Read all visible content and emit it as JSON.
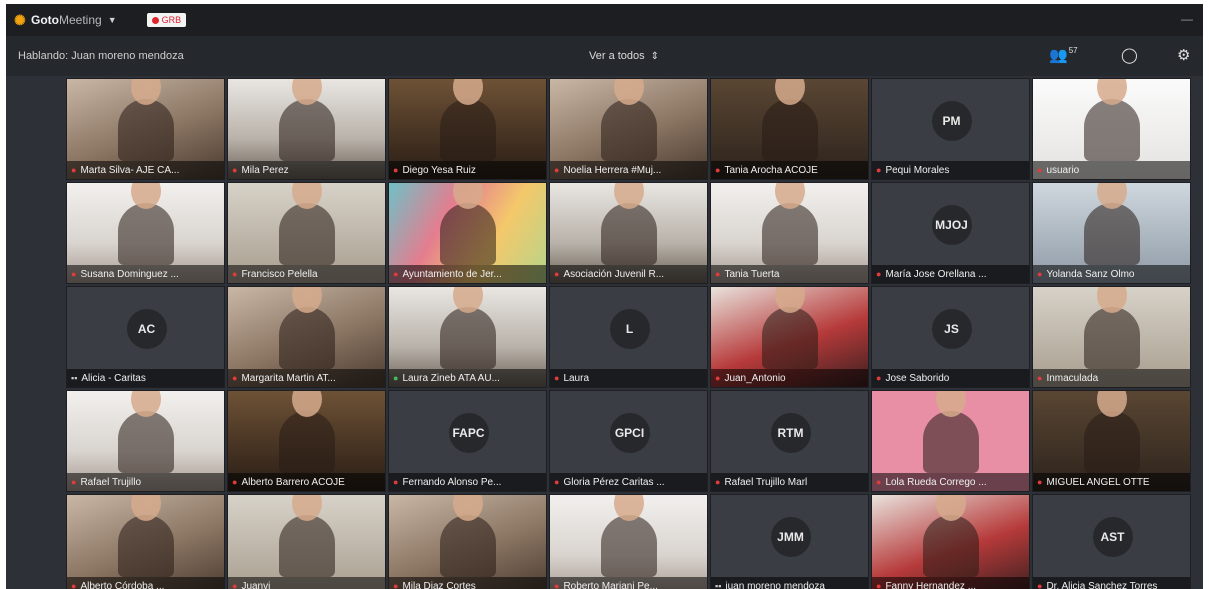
{
  "app": {
    "brand_a": "Goto",
    "brand_b": "Meeting",
    "rec_label": "GRB"
  },
  "toolbar": {
    "speaking": "Hablando: Juan moreno mendoza",
    "view_all": "Ver a todos",
    "participant_count": "57"
  },
  "colors": {
    "bg": "#2a2d33",
    "brand_orange": "#f2a30f",
    "mic_muted": "#e23b3b",
    "mic_active": "#3fbf5a"
  },
  "tiles": [
    {
      "name": "Marta Silva- AJE CA...",
      "mic": "muted",
      "style": "v-warm"
    },
    {
      "name": "Mila Perez",
      "mic": "muted",
      "style": "v-room"
    },
    {
      "name": "Diego Yesa Ruiz",
      "mic": "muted",
      "style": "v-shelf"
    },
    {
      "name": "Noelia Herrera #Muj...",
      "mic": "muted",
      "style": "v-warm"
    },
    {
      "name": "Tania Arocha ACOJE",
      "mic": "muted",
      "style": "v-dark"
    },
    {
      "name": "Pequi Morales",
      "mic": "muted",
      "avatar": "PM"
    },
    {
      "name": "usuario",
      "mic": "muted",
      "style": "v-white"
    },
    {
      "name": "Susana Dominguez ...",
      "mic": "muted",
      "style": "v-light"
    },
    {
      "name": "Francisco Pelella",
      "mic": "muted",
      "style": "v-office"
    },
    {
      "name": "Ayuntamiento de Jer...",
      "mic": "muted",
      "style": "v-color"
    },
    {
      "name": "Asociación Juvenil R...",
      "mic": "muted",
      "style": "v-room"
    },
    {
      "name": "Tania Tuerta",
      "mic": "muted",
      "style": "v-light"
    },
    {
      "name": "María Jose Orellana ...",
      "mic": "muted",
      "avatar": "MJOJ"
    },
    {
      "name": "Yolanda Sanz Olmo",
      "mic": "muted",
      "style": "v-blue"
    },
    {
      "name": "Alicia - Caritas",
      "mic": "white",
      "avatar": "AC"
    },
    {
      "name": "Margarita Martin AT...",
      "mic": "muted",
      "style": "v-warm"
    },
    {
      "name": "Laura Zineb ATA AU...",
      "mic": "on",
      "style": "v-room"
    },
    {
      "name": "Laura",
      "mic": "muted",
      "avatar": "L"
    },
    {
      "name": "Juan_Antonio",
      "mic": "muted",
      "style": "v-red"
    },
    {
      "name": "Jose Saborido",
      "mic": "muted",
      "avatar": "JS"
    },
    {
      "name": "Inmaculada",
      "mic": "muted",
      "style": "v-office"
    },
    {
      "name": "Rafael Trujillo",
      "mic": "muted",
      "style": "v-light"
    },
    {
      "name": "Alberto Barrero ACOJE",
      "mic": "muted",
      "style": "v-shelf"
    },
    {
      "name": "Fernando Alonso Pe...",
      "mic": "muted",
      "avatar": "FAPC"
    },
    {
      "name": "Gloria Pérez Caritas ...",
      "mic": "muted",
      "avatar": "GPCI"
    },
    {
      "name": "Rafael Trujillo Marl",
      "mic": "muted",
      "avatar": "RTM"
    },
    {
      "name": "Lola Rueda Corrego ...",
      "mic": "muted",
      "style": "v-pink"
    },
    {
      "name": "MIGUEL ANGEL OTTE",
      "mic": "muted",
      "style": "v-dark"
    },
    {
      "name": "Alberto Córdoba ...",
      "mic": "muted",
      "style": "v-warm"
    },
    {
      "name": "Juanvi",
      "mic": "muted",
      "style": "v-office"
    },
    {
      "name": "Mila Diaz Cortes",
      "mic": "muted",
      "style": "v-warm"
    },
    {
      "name": "Roberto Mariani Pe...",
      "mic": "muted",
      "style": "v-light"
    },
    {
      "name": "juan moreno mendoza",
      "mic": "white",
      "avatar": "JMM"
    },
    {
      "name": "Fanny Hernandez ...",
      "mic": "muted",
      "style": "v-red"
    },
    {
      "name": "Dr. Alicia Sanchez Torres",
      "mic": "muted",
      "avatar": "AST"
    }
  ]
}
